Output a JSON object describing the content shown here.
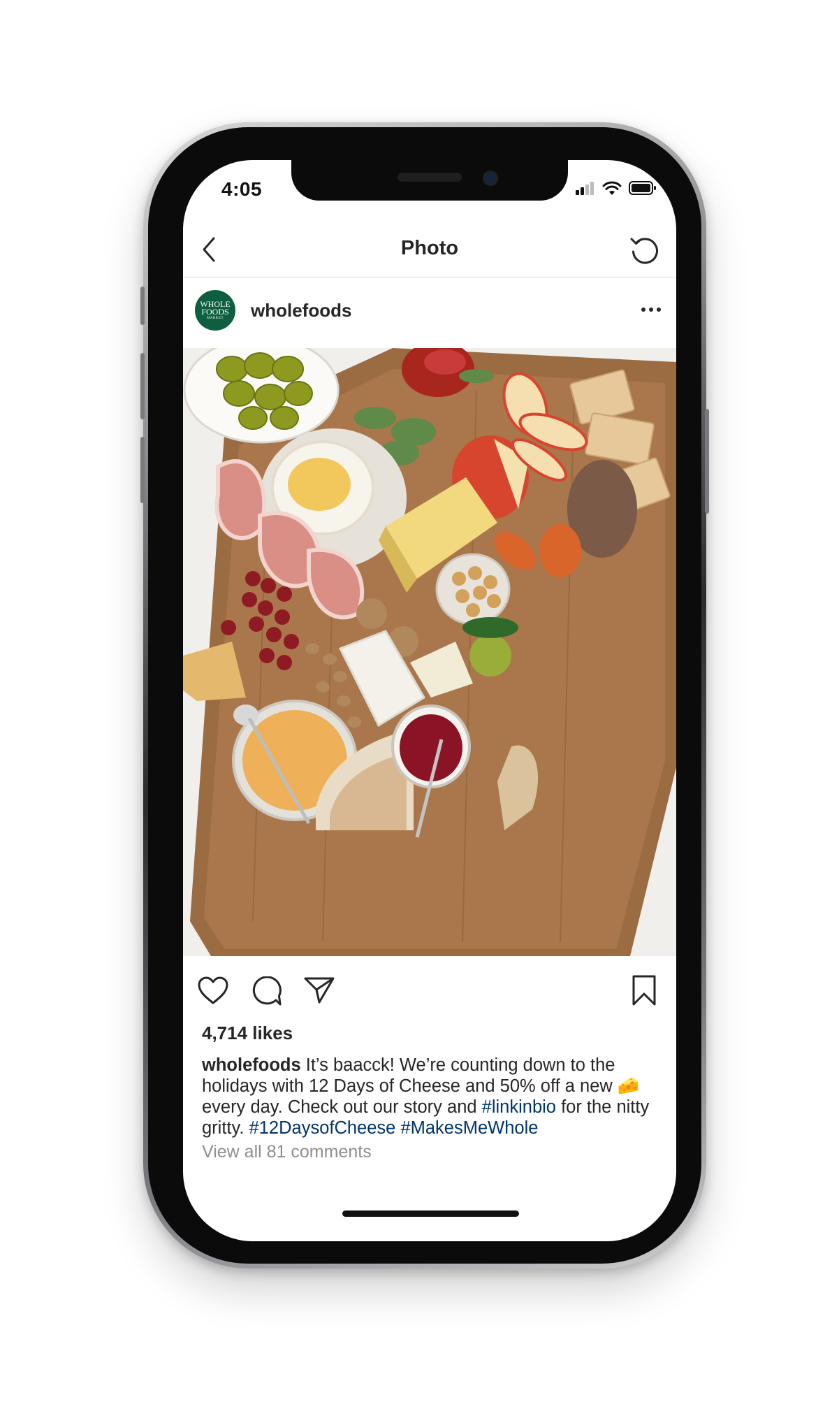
{
  "status_bar": {
    "time": "4:05"
  },
  "nav": {
    "title": "Photo"
  },
  "post": {
    "username": "wholefoods",
    "avatar_text": [
      "WHOLE",
      "FOODS",
      "MARKET"
    ],
    "likes": "4,714 likes",
    "caption": {
      "username": "wholefoods",
      "text_1": " It’s baacck! We’re counting down to the holidays with 12 Days of Cheese and 50% off a new ",
      "emoji": "🧀",
      "text_2": " every day. Check out our story and ",
      "tag_linkinbio": "#linkinbio",
      "text_3": " for the nitty gritty. ",
      "tag_1": "#12DaysofCheese",
      "tag_2": "#MakesMeWhole"
    },
    "view_comments": "View all 81 comments"
  },
  "colors": {
    "brand_green": "#0d5f3f",
    "hashtag_blue": "#003569",
    "muted_gray": "#8e8e8e"
  },
  "icons": [
    "back-chevron-icon",
    "refresh-icon",
    "more-icon",
    "heart-icon",
    "comment-icon",
    "share-icon",
    "bookmark-icon",
    "signal-icon",
    "wifi-icon",
    "battery-icon"
  ]
}
